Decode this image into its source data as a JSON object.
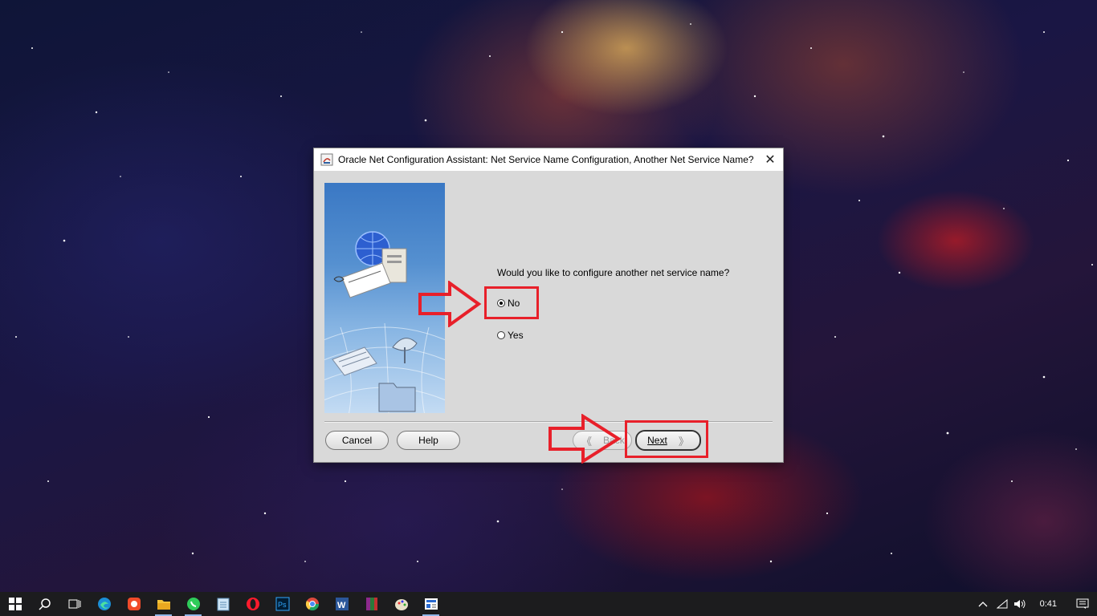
{
  "window": {
    "title": "Oracle Net Configuration Assistant: Net Service Name Configuration, Another Net Service Name?",
    "close_glyph": "✕"
  },
  "content": {
    "question": "Would you like to configure another net service name?",
    "options": [
      {
        "label": "No",
        "selected": true
      },
      {
        "label": "Yes",
        "selected": false
      }
    ]
  },
  "buttons": {
    "cancel": "Cancel",
    "help": "Help",
    "back": "Back",
    "next": "Next",
    "back_chevron": "《",
    "next_chevron": "》"
  },
  "annotation_color": "#e8202a",
  "taskbar": {
    "apps": [
      "start-icon",
      "search-icon",
      "task-view-icon",
      "edge-icon",
      "camera-app-icon",
      "file-explorer-icon",
      "whatsapp-icon",
      "notepad-icon",
      "opera-icon",
      "photoshop-icon",
      "chrome-icon",
      "word-icon",
      "winrar-icon",
      "paint-icon",
      "news-icon"
    ],
    "time": "0:41"
  }
}
